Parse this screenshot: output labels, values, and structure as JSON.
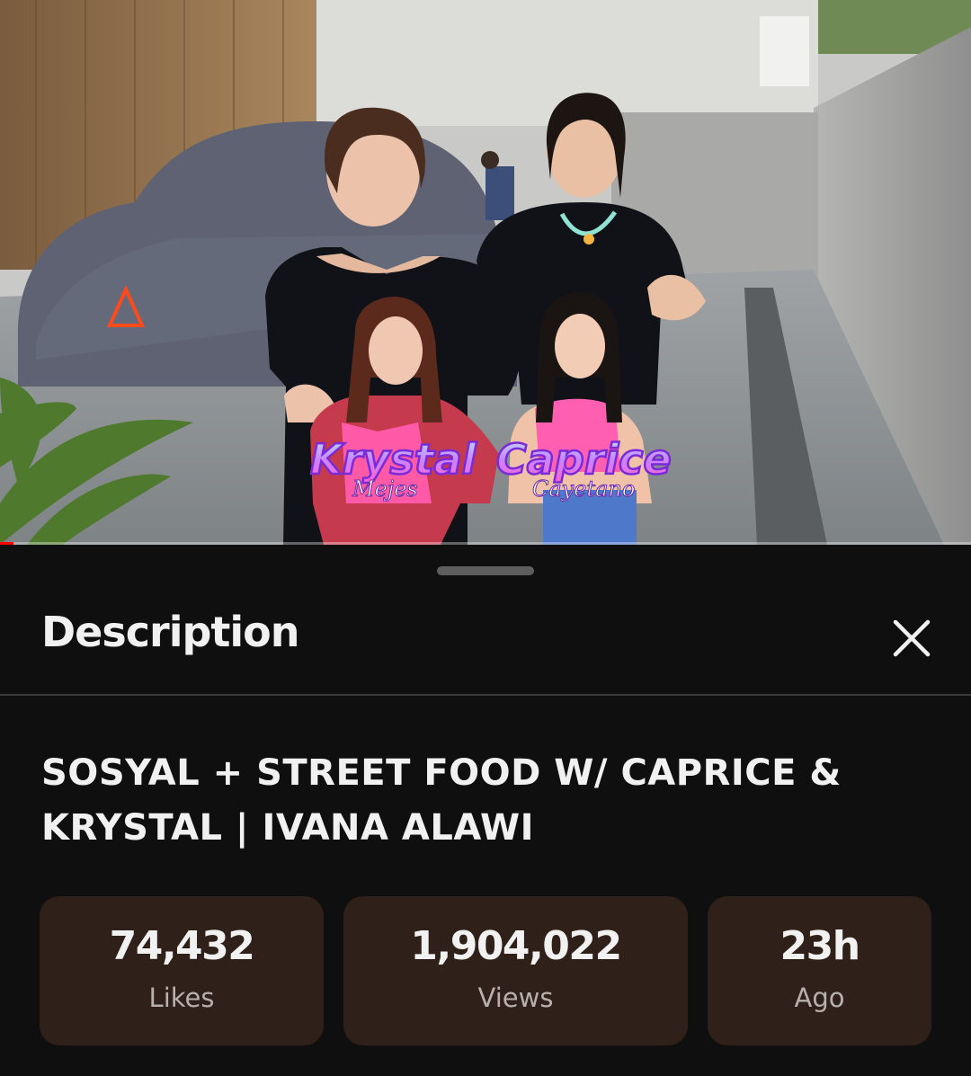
{
  "video": {
    "overlay_names": [
      {
        "first": "Krystal",
        "last": "Mejes"
      },
      {
        "first": "Caprice",
        "last": "Cayetano"
      }
    ],
    "progress": 0.014,
    "progress_color": "#ff0000"
  },
  "sheet": {
    "title": "Description",
    "close_icon": "close-icon",
    "video_title_line1": "SOSYAL + STREET FOOD W/ CAPRICE &",
    "video_title_line2": "KRYSTAL | IVANA ALAWI",
    "stats": [
      {
        "value": "74,432",
        "label": "Likes"
      },
      {
        "value": "1,904,022",
        "label": "Views"
      },
      {
        "value": "23h",
        "label": "Ago"
      }
    ],
    "stat_bg_color": "#2f2019"
  }
}
